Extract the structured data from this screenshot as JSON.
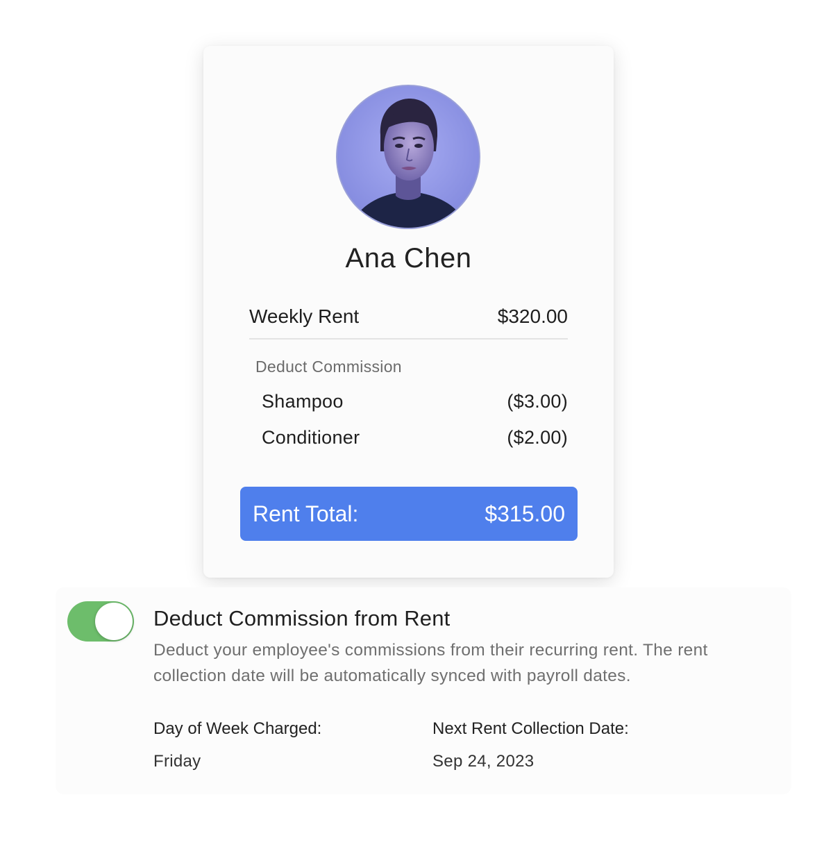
{
  "profile": {
    "name": "Ana Chen"
  },
  "rent": {
    "label": "Weekly Rent",
    "amount": "$320.00"
  },
  "commission": {
    "section_label": "Deduct Commission",
    "items": [
      {
        "label": "Shampoo",
        "amount": "($3.00)"
      },
      {
        "label": "Conditioner",
        "amount": "($2.00)"
      }
    ]
  },
  "total": {
    "label": "Rent Total:",
    "amount": "$315.00"
  },
  "setting": {
    "enabled": true,
    "title": "Deduct Commission from Rent",
    "description": "Deduct your employee's commissions from their recurring rent. The rent collection date will be automatically synced with payroll dates.",
    "day_label": "Day of Week Charged:",
    "day_value": "Friday",
    "next_label": "Next Rent Collection Date:",
    "next_value": "Sep 24, 2023"
  },
  "colors": {
    "accent_blue": "#4f7fec",
    "toggle_green": "#6dbd6b"
  }
}
